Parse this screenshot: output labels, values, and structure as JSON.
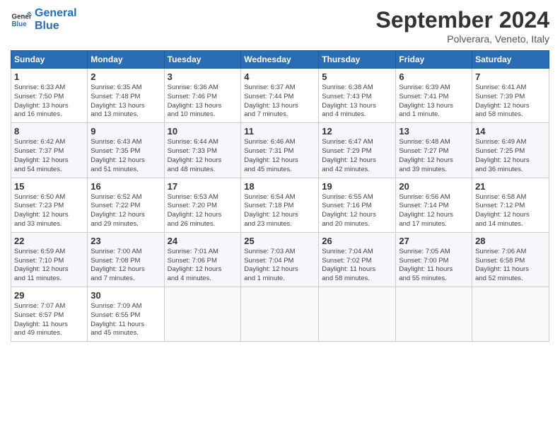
{
  "header": {
    "logo_line1": "General",
    "logo_line2": "Blue",
    "month_year": "September 2024",
    "location": "Polverara, Veneto, Italy"
  },
  "weekdays": [
    "Sunday",
    "Monday",
    "Tuesday",
    "Wednesday",
    "Thursday",
    "Friday",
    "Saturday"
  ],
  "weeks": [
    [
      {
        "day": "1",
        "info": "Sunrise: 6:33 AM\nSunset: 7:50 PM\nDaylight: 13 hours\nand 16 minutes."
      },
      {
        "day": "2",
        "info": "Sunrise: 6:35 AM\nSunset: 7:48 PM\nDaylight: 13 hours\nand 13 minutes."
      },
      {
        "day": "3",
        "info": "Sunrise: 6:36 AM\nSunset: 7:46 PM\nDaylight: 13 hours\nand 10 minutes."
      },
      {
        "day": "4",
        "info": "Sunrise: 6:37 AM\nSunset: 7:44 PM\nDaylight: 13 hours\nand 7 minutes."
      },
      {
        "day": "5",
        "info": "Sunrise: 6:38 AM\nSunset: 7:43 PM\nDaylight: 13 hours\nand 4 minutes."
      },
      {
        "day": "6",
        "info": "Sunrise: 6:39 AM\nSunset: 7:41 PM\nDaylight: 13 hours\nand 1 minute."
      },
      {
        "day": "7",
        "info": "Sunrise: 6:41 AM\nSunset: 7:39 PM\nDaylight: 12 hours\nand 58 minutes."
      }
    ],
    [
      {
        "day": "8",
        "info": "Sunrise: 6:42 AM\nSunset: 7:37 PM\nDaylight: 12 hours\nand 54 minutes."
      },
      {
        "day": "9",
        "info": "Sunrise: 6:43 AM\nSunset: 7:35 PM\nDaylight: 12 hours\nand 51 minutes."
      },
      {
        "day": "10",
        "info": "Sunrise: 6:44 AM\nSunset: 7:33 PM\nDaylight: 12 hours\nand 48 minutes."
      },
      {
        "day": "11",
        "info": "Sunrise: 6:46 AM\nSunset: 7:31 PM\nDaylight: 12 hours\nand 45 minutes."
      },
      {
        "day": "12",
        "info": "Sunrise: 6:47 AM\nSunset: 7:29 PM\nDaylight: 12 hours\nand 42 minutes."
      },
      {
        "day": "13",
        "info": "Sunrise: 6:48 AM\nSunset: 7:27 PM\nDaylight: 12 hours\nand 39 minutes."
      },
      {
        "day": "14",
        "info": "Sunrise: 6:49 AM\nSunset: 7:25 PM\nDaylight: 12 hours\nand 36 minutes."
      }
    ],
    [
      {
        "day": "15",
        "info": "Sunrise: 6:50 AM\nSunset: 7:23 PM\nDaylight: 12 hours\nand 33 minutes."
      },
      {
        "day": "16",
        "info": "Sunrise: 6:52 AM\nSunset: 7:22 PM\nDaylight: 12 hours\nand 29 minutes."
      },
      {
        "day": "17",
        "info": "Sunrise: 6:53 AM\nSunset: 7:20 PM\nDaylight: 12 hours\nand 26 minutes."
      },
      {
        "day": "18",
        "info": "Sunrise: 6:54 AM\nSunset: 7:18 PM\nDaylight: 12 hours\nand 23 minutes."
      },
      {
        "day": "19",
        "info": "Sunrise: 6:55 AM\nSunset: 7:16 PM\nDaylight: 12 hours\nand 20 minutes."
      },
      {
        "day": "20",
        "info": "Sunrise: 6:56 AM\nSunset: 7:14 PM\nDaylight: 12 hours\nand 17 minutes."
      },
      {
        "day": "21",
        "info": "Sunrise: 6:58 AM\nSunset: 7:12 PM\nDaylight: 12 hours\nand 14 minutes."
      }
    ],
    [
      {
        "day": "22",
        "info": "Sunrise: 6:59 AM\nSunset: 7:10 PM\nDaylight: 12 hours\nand 11 minutes."
      },
      {
        "day": "23",
        "info": "Sunrise: 7:00 AM\nSunset: 7:08 PM\nDaylight: 12 hours\nand 7 minutes."
      },
      {
        "day": "24",
        "info": "Sunrise: 7:01 AM\nSunset: 7:06 PM\nDaylight: 12 hours\nand 4 minutes."
      },
      {
        "day": "25",
        "info": "Sunrise: 7:03 AM\nSunset: 7:04 PM\nDaylight: 12 hours\nand 1 minute."
      },
      {
        "day": "26",
        "info": "Sunrise: 7:04 AM\nSunset: 7:02 PM\nDaylight: 11 hours\nand 58 minutes."
      },
      {
        "day": "27",
        "info": "Sunrise: 7:05 AM\nSunset: 7:00 PM\nDaylight: 11 hours\nand 55 minutes."
      },
      {
        "day": "28",
        "info": "Sunrise: 7:06 AM\nSunset: 6:58 PM\nDaylight: 11 hours\nand 52 minutes."
      }
    ],
    [
      {
        "day": "29",
        "info": "Sunrise: 7:07 AM\nSunset: 6:57 PM\nDaylight: 11 hours\nand 49 minutes."
      },
      {
        "day": "30",
        "info": "Sunrise: 7:09 AM\nSunset: 6:55 PM\nDaylight: 11 hours\nand 45 minutes."
      },
      {
        "day": "",
        "info": ""
      },
      {
        "day": "",
        "info": ""
      },
      {
        "day": "",
        "info": ""
      },
      {
        "day": "",
        "info": ""
      },
      {
        "day": "",
        "info": ""
      }
    ]
  ]
}
